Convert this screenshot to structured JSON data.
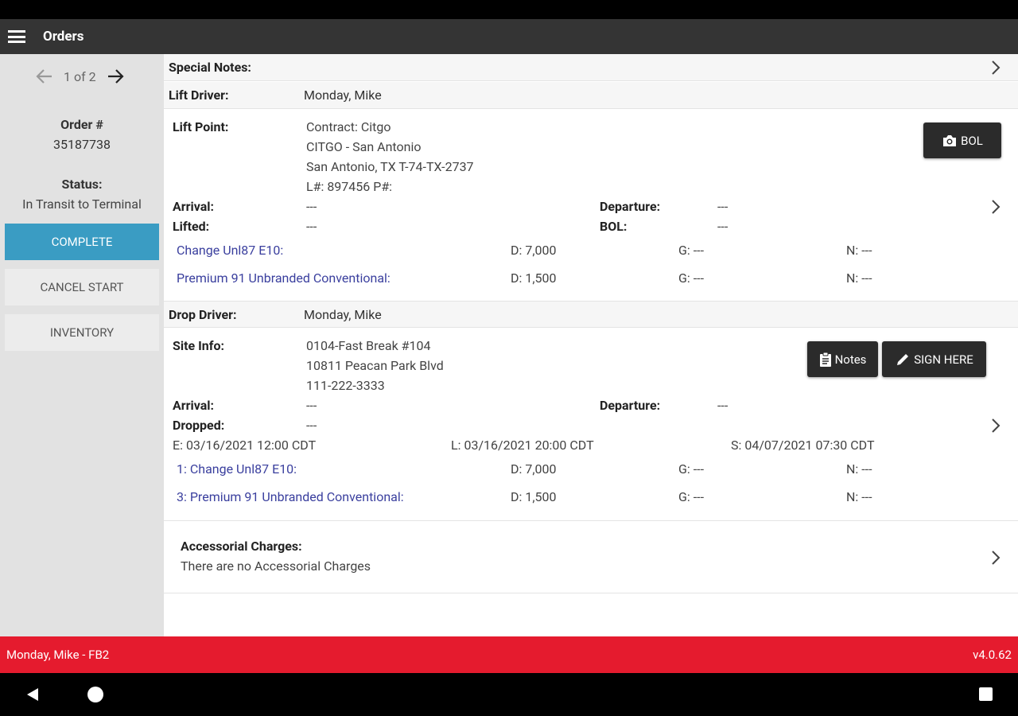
{
  "appbar": {
    "title": "Orders"
  },
  "sidebar": {
    "pager_text": "1 of 2",
    "order_label": "Order #",
    "order_number": "35187738",
    "status_label": "Status:",
    "status_value": "In Transit to Terminal",
    "complete_label": "COMPLETE",
    "cancel_label": "CANCEL START",
    "inventory_label": "INVENTORY"
  },
  "special_notes": {
    "label": "Special Notes:"
  },
  "lift": {
    "driver_label": "Lift Driver:",
    "driver_value": "Monday, Mike",
    "point_label": "Lift Point:",
    "point_lines": [
      "Contract: Citgo",
      "CITGO - San Antonio",
      "San Antonio, TX T-74-TX-2737",
      "L#: 897456 P#:"
    ],
    "bol_button": "BOL",
    "arrival_label": "Arrival:",
    "arrival_value": "---",
    "lifted_label": "Lifted:",
    "lifted_value": "---",
    "departure_label": "Departure:",
    "departure_value": "---",
    "bol_label": "BOL:",
    "bol_value": "---",
    "products": [
      {
        "name": "Change Unl87 E10:",
        "d": "D: 7,000",
        "g": "G: ---",
        "n": "N: ---"
      },
      {
        "name": "Premium 91 Unbranded Conventional:",
        "d": "D: 1,500",
        "g": "G: ---",
        "n": "N: ---"
      }
    ]
  },
  "drop": {
    "driver_label": "Drop Driver:",
    "driver_value": "Monday, Mike",
    "site_label": "Site Info:",
    "site_lines": [
      "0104-Fast Break #104",
      "10811 Peacan Park Blvd",
      "111-222-3333"
    ],
    "notes_button": "Notes",
    "sign_button": "SIGN HERE",
    "arrival_label": "Arrival:",
    "arrival_value": "---",
    "dropped_label": "Dropped:",
    "dropped_value": "---",
    "departure_label": "Departure:",
    "departure_value": "---",
    "window_e": "E: 03/16/2021 12:00 CDT",
    "window_l": "L: 03/16/2021 20:00 CDT",
    "window_s": "S: 04/07/2021 07:30 CDT",
    "products": [
      {
        "name": "1: Change Unl87 E10:",
        "d": "D: 7,000",
        "g": "G: ---",
        "n": "N: ---"
      },
      {
        "name": "3: Premium 91 Unbranded Conventional:",
        "d": "D: 1,500",
        "g": "G: ---",
        "n": "N: ---"
      }
    ]
  },
  "accessorial": {
    "label": "Accessorial Charges:",
    "value": "There are no Accessorial Charges"
  },
  "footer": {
    "user": "Monday, Mike - FB2",
    "version": "v4.0.62"
  },
  "colors": {
    "accent": "#3a9cc3",
    "footer": "#e51b2e",
    "appbar": "#343434",
    "link": "#3a3f9e"
  }
}
